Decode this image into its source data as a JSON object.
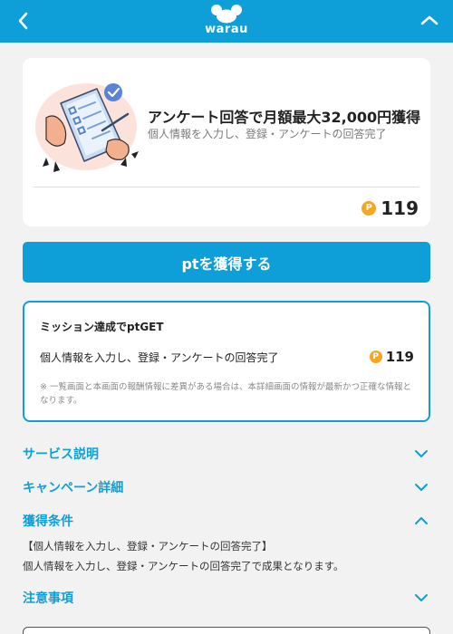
{
  "header": {
    "logo_text": "warau",
    "back_icon": "chevron-left-icon",
    "collapse_icon": "chevron-up-icon",
    "brand_color": "#0e9fd8"
  },
  "offer": {
    "title": "アンケート回答で月額最大32,000円獲得",
    "subtitle": "個人情報を入力し、登録・アンケートの回答完了",
    "coin_symbol": "P",
    "points": "119",
    "illustration_icon": "survey-form-illustration"
  },
  "cta": {
    "label": "ptを獲得する"
  },
  "mission": {
    "heading": "ミッション達成でptGET",
    "row_label": "個人情報を入力し、登録・アンケートの回答完了",
    "coin_symbol": "P",
    "row_points": "119",
    "note": "※ 一覧画面と本画面の報酬情報に差異がある場合は、本詳細画面の情報が最新かつ正確な情報となります。"
  },
  "accordion": {
    "service": {
      "label": "サービス説明",
      "state": "collapsed"
    },
    "campaign": {
      "label": "キャンペーン詳細",
      "state": "collapsed"
    },
    "conditions": {
      "label": "獲得条件",
      "state": "expanded",
      "line1": "【個人情報を入力し、登録・アンケートの回答完了】",
      "line2": "個人情報を入力し、登録・アンケートの回答完了で成果となります。"
    },
    "notes": {
      "label": "注意事項",
      "state": "collapsed"
    }
  },
  "colors": {
    "accent": "#0e9fd8",
    "coin": "#f5a623",
    "background": "#f2f2f2"
  }
}
